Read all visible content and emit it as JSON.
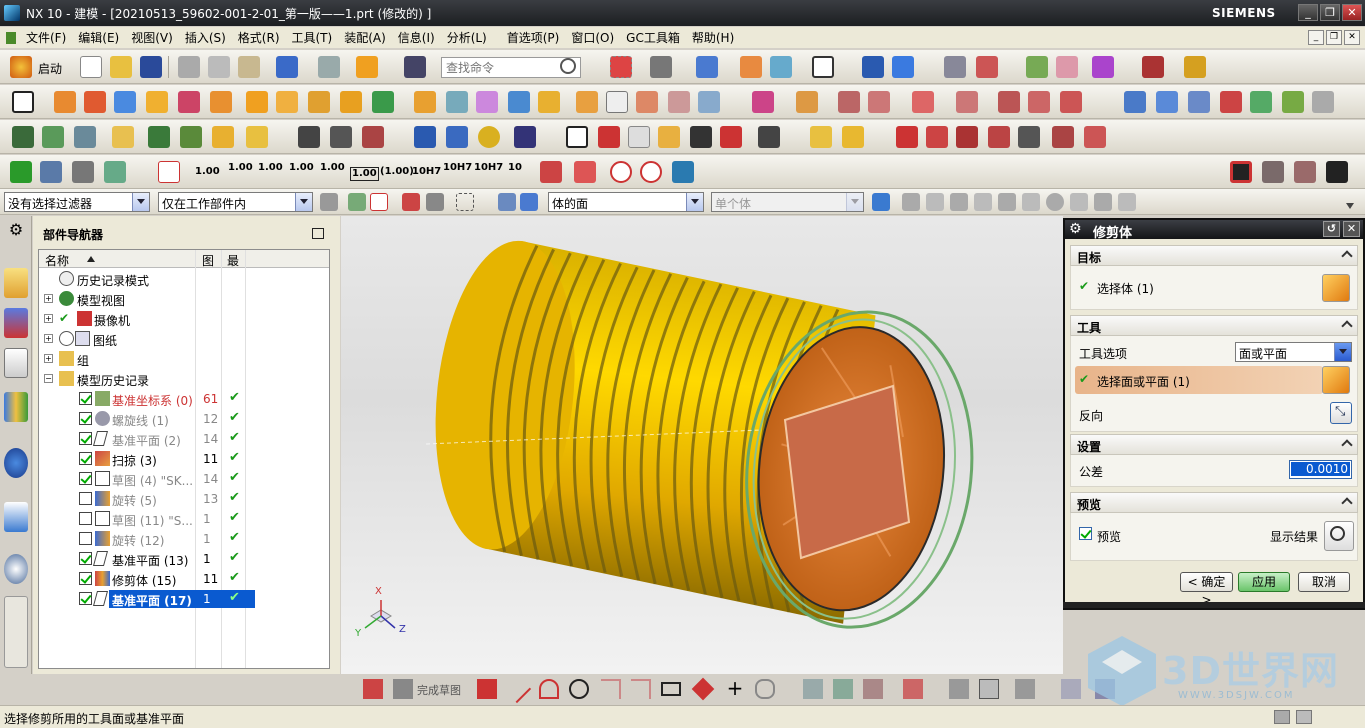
{
  "window": {
    "title": "NX 10 - 建模 - [20210513_59602-001-2-01_第一版——1.prt  (修改的) ]",
    "brand": "SIEMENS",
    "controls": [
      "_",
      "❐",
      "✕"
    ]
  },
  "menu": {
    "items": [
      "文件(F)",
      "编辑(E)",
      "视图(V)",
      "插入(S)",
      "格式(R)",
      "工具(T)",
      "装配(A)",
      "信息(I)",
      "分析(L)",
      "首选项(P)",
      "窗口(O)",
      "GC工具箱",
      "帮助(H)"
    ]
  },
  "toolbar1": {
    "start_label": "启动",
    "search_placeholder": "查找命令"
  },
  "toolbar4": {
    "dims": [
      "1.00",
      "1.00",
      "1.00",
      "1.00",
      "1.00",
      "1.00",
      "1.00",
      "(1.00)",
      "10H7",
      "10H7",
      "10H7",
      "10"
    ]
  },
  "filterbar": {
    "selection_filter": "没有选择过滤器",
    "scope": "仅在工作部件内",
    "face_rule": "体的面",
    "single_body": "单个体"
  },
  "part_navigator": {
    "title": "部件导航器",
    "columns": {
      "name": "名称",
      "picture": "图",
      "latest": "最"
    },
    "rows": [
      {
        "label": "历史记录模式",
        "num": "",
        "check": ""
      },
      {
        "label": "模型视图",
        "num": "",
        "check": ""
      },
      {
        "label": "摄像机",
        "num": "",
        "check": ""
      },
      {
        "label": "图纸",
        "num": "",
        "check": ""
      },
      {
        "label": "组",
        "num": "",
        "check": ""
      },
      {
        "label": "模型历史记录",
        "num": "",
        "check": ""
      },
      {
        "label": "基准坐标系 (0)",
        "num": "61",
        "check": "✔"
      },
      {
        "label": "螺旋线 (1)",
        "num": "12",
        "check": "✔"
      },
      {
        "label": "基准平面 (2)",
        "num": "14",
        "check": "✔"
      },
      {
        "label": "扫掠 (3)",
        "num": "11",
        "check": "✔"
      },
      {
        "label": "草图 (4) \"SK...",
        "num": "14",
        "check": "✔"
      },
      {
        "label": "旋转 (5)",
        "num": "13",
        "check": "✔"
      },
      {
        "label": "草图 (11) \"S...",
        "num": "1",
        "check": "✔"
      },
      {
        "label": "旋转 (12)",
        "num": "1",
        "check": "✔"
      },
      {
        "label": "基准平面 (13)",
        "num": "1",
        "check": "✔"
      },
      {
        "label": "修剪体 (15)",
        "num": "11",
        "check": "✔"
      },
      {
        "label": "基准平面 (17)",
        "num": "1",
        "check": "✔"
      }
    ]
  },
  "trim_body_dialog": {
    "title": "修剪体",
    "target": {
      "header": "目标",
      "select_body": "选择体 (1)"
    },
    "tool": {
      "header": "工具",
      "tool_option_label": "工具选项",
      "tool_option_value": "面或平面",
      "select_face": "选择面或平面 (1)",
      "reverse": "反向"
    },
    "settings": {
      "header": "设置",
      "tolerance_label": "公差",
      "tolerance_value": "0.0010"
    },
    "preview": {
      "header": "预览",
      "preview_label": "预览",
      "show_result": "显示结果"
    },
    "buttons": {
      "ok": "< 确定 >",
      "apply": "应用",
      "cancel": "取消"
    }
  },
  "sketch_toolbar": {
    "finish_sketch": "完成草图"
  },
  "triad": {
    "x": "X",
    "y": "Y",
    "z": "Z"
  },
  "status": {
    "message": "选择修剪所用的工具面或基准平面"
  },
  "watermark": {
    "text": "3D世界网",
    "url": "WWW.3DSJW.COM"
  },
  "colors": {
    "model_yellow": "#f2c800",
    "cut_face": "#d97a3a",
    "plane": "#c06a48",
    "accent_green": "#1a9a1a"
  }
}
